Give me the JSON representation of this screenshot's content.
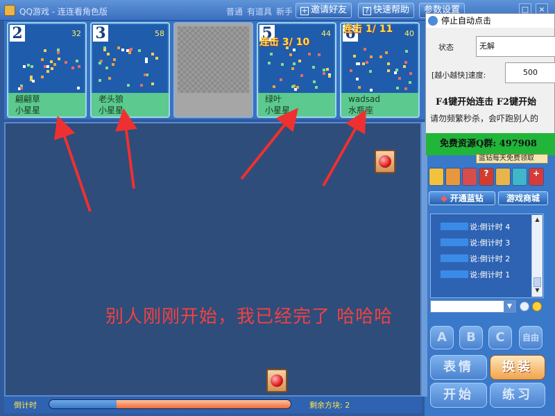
{
  "window": {
    "title": "QQ游戏 - 连连看角色版",
    "mode_links": [
      "普通",
      "有道具",
      "新手"
    ],
    "invite_label": "邀请好友",
    "help_label": "快速帮助",
    "settings_label": "参数设置"
  },
  "players": [
    {
      "seat": "2",
      "score": "32",
      "name": "翩翩草",
      "rank": "小星星",
      "combo": ""
    },
    {
      "seat": "3",
      "score": "58",
      "name": "老头狼",
      "rank": "小星星",
      "combo": ""
    },
    {
      "seat": "5",
      "score": "44",
      "name": "绿叶",
      "rank": "小星星",
      "combo": "连击 3/ 10"
    },
    {
      "seat": "6",
      "score": "40",
      "name": "wadsad",
      "rank": "水瓶座",
      "combo": "连击 1/ 11"
    }
  ],
  "annotation": "别人刚刚开始，我已经完了 哈哈哈",
  "timer": {
    "label": "倒计时",
    "remaining_fraction": 0.72
  },
  "blocks": {
    "label": "剩余方块:",
    "count": "2"
  },
  "helper": {
    "title": "停止自动点击",
    "status_label": "状态",
    "status_value": "无解",
    "speed_label": "[越小越快]速度:",
    "speed_value": "500",
    "hotkeys": "F4键开始连击  F2键开始",
    "warning": "请勿频繁秒杀，会吓跑别人的",
    "qq_group": "免费资源Q群: 497908"
  },
  "tooltip": "蓝钻每天免费领取",
  "buttons": {
    "blue_diamond": "开通蓝钻",
    "shop": "游戏商城",
    "abc": [
      "A",
      "B",
      "C"
    ],
    "custom": "自由人",
    "expression": "表情",
    "change": "换装",
    "start": "开始",
    "practice": "练习"
  },
  "chat": {
    "prefix": "说:",
    "lines": [
      "倒计时 4",
      "倒计时 3",
      "倒计时 2",
      "倒计时 1"
    ]
  },
  "colors": {
    "annotation_red": "#f24141",
    "name_green": "#5cc98e",
    "qq_green": "#21b53a",
    "score_yellow": "#fff15a"
  }
}
